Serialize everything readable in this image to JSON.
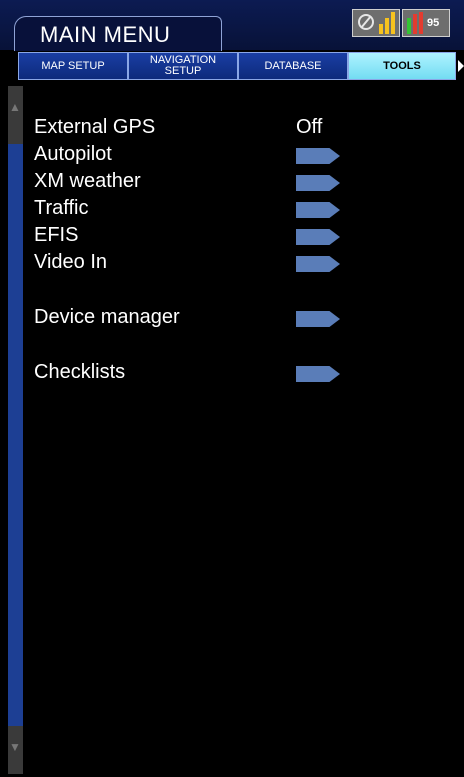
{
  "header": {
    "title": "MAIN MENU"
  },
  "status": {
    "signal_value": "95"
  },
  "tabs": [
    {
      "line1": "MAP SETUP",
      "line2": ""
    },
    {
      "line1": "NAVIGATION",
      "line2": "SETUP"
    },
    {
      "line1": "DATABASE",
      "line2": ""
    },
    {
      "line1": "TOOLS",
      "line2": ""
    }
  ],
  "menu": {
    "external_gps": {
      "label": "External GPS",
      "value": "Off"
    },
    "autopilot": {
      "label": "Autopilot"
    },
    "xm_weather": {
      "label": "XM weather"
    },
    "traffic": {
      "label": "Traffic"
    },
    "efis": {
      "label": "EFIS"
    },
    "video_in": {
      "label": "Video In"
    },
    "device_manager": {
      "label": "Device manager"
    },
    "checklists": {
      "label": "Checklists"
    }
  },
  "colors": {
    "active_tab": "#8fe9ff",
    "arrow": "#5a7db8",
    "header": "#0c1b52"
  }
}
